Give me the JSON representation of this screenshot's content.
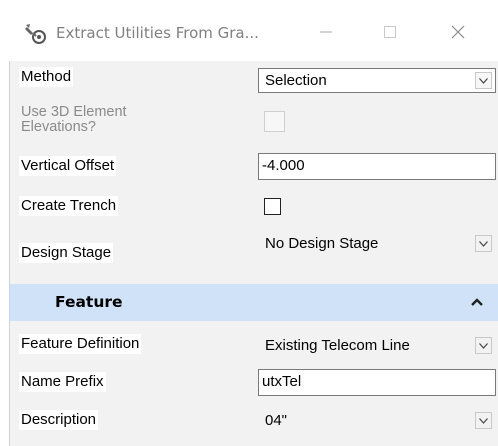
{
  "window": {
    "title": "Extract Utilities From Gra...",
    "app_icon": "wrench-gear-icon",
    "min_icon": "minimize-icon",
    "max_icon": "maximize-icon",
    "close_icon": "close-icon"
  },
  "form": {
    "method": {
      "label": "Method",
      "value": "Selection"
    },
    "use3d": {
      "label_line1": "Use 3D Element",
      "label_line2": "Elevations?",
      "checked": false,
      "enabled": false
    },
    "vertical_offset": {
      "label": "Vertical Offset",
      "value": "-4.000"
    },
    "create_trench": {
      "label": "Create Trench",
      "checked": false
    },
    "design_stage": {
      "label": "Design Stage",
      "value": "No Design Stage"
    }
  },
  "feature_section": {
    "title": "Feature",
    "collapse_icon": "chevron-up-icon",
    "feature_definition": {
      "label": "Feature Definition",
      "value": "Existing Telecom Line"
    },
    "name_prefix": {
      "label": "Name Prefix",
      "value": "utxTel"
    },
    "description": {
      "label": "Description",
      "value": "04\""
    }
  },
  "colors": {
    "section_header_bg": "#d0e2f7",
    "panel_bg": "#f2f2f2",
    "title_text": "#808080"
  }
}
